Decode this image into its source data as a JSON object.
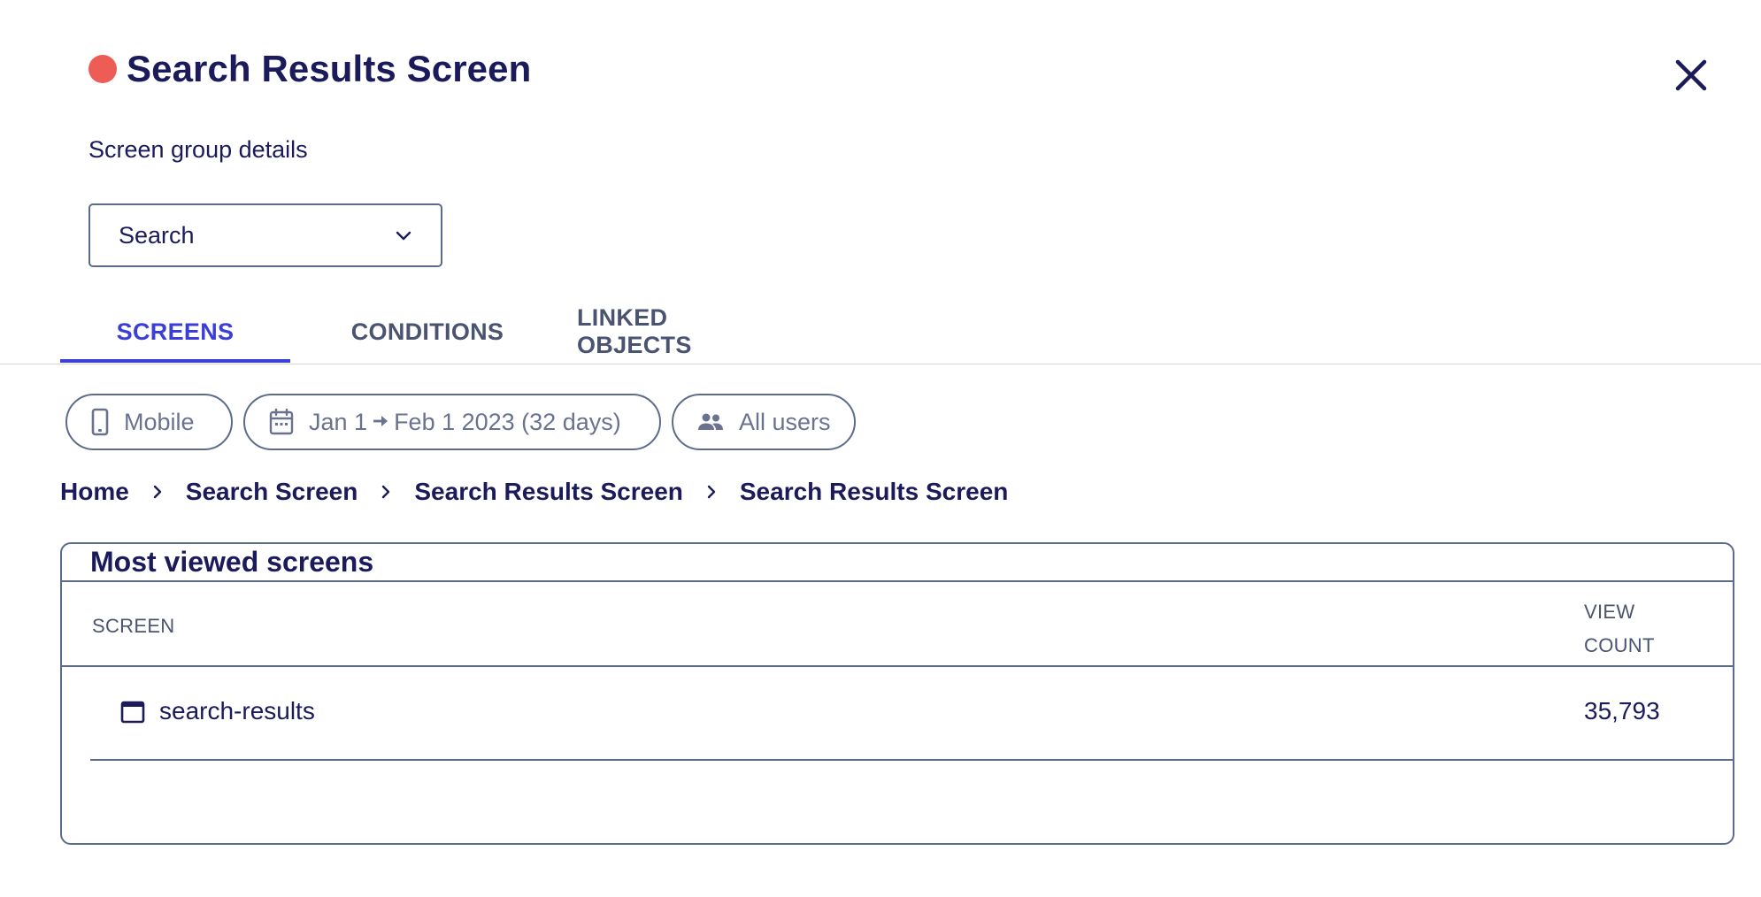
{
  "header": {
    "title": "Search Results Screen",
    "status_color": "#ee5d55",
    "close_icon": "close-icon"
  },
  "subtitle": "Screen group details",
  "dropdown": {
    "value": "Search",
    "icon": "chevron-down-icon"
  },
  "tabs": [
    {
      "label": "SCREENS",
      "active": true
    },
    {
      "label": "CONDITIONS",
      "active": false
    },
    {
      "label": "LINKED OBJECTS",
      "active": false
    }
  ],
  "filters": {
    "device": {
      "label": "Mobile",
      "icon": "mobile-phone-icon"
    },
    "date": {
      "start": "Jan 1",
      "end": "Feb 1 2023 (32 days)",
      "icon": "calendar-icon",
      "separator_icon": "arrow-right-icon"
    },
    "audience": {
      "label": "All users",
      "icon": "users-icon"
    }
  },
  "breadcrumb": [
    "Home",
    "Search Screen",
    "Search Results Screen",
    "Search Results Screen"
  ],
  "most_viewed": {
    "title": "Most viewed screens",
    "columns": {
      "screen": "SCREEN",
      "view_count_line1": "VIEW",
      "view_count_line2": "COUNT"
    },
    "rows": [
      {
        "name": "search-results",
        "count": "35,793",
        "icon": "window-icon"
      }
    ]
  },
  "colors": {
    "accent": "#3b3fd8",
    "text": "#1b1a5a",
    "muted": "#4a5470",
    "border": "#5c6b8a"
  }
}
